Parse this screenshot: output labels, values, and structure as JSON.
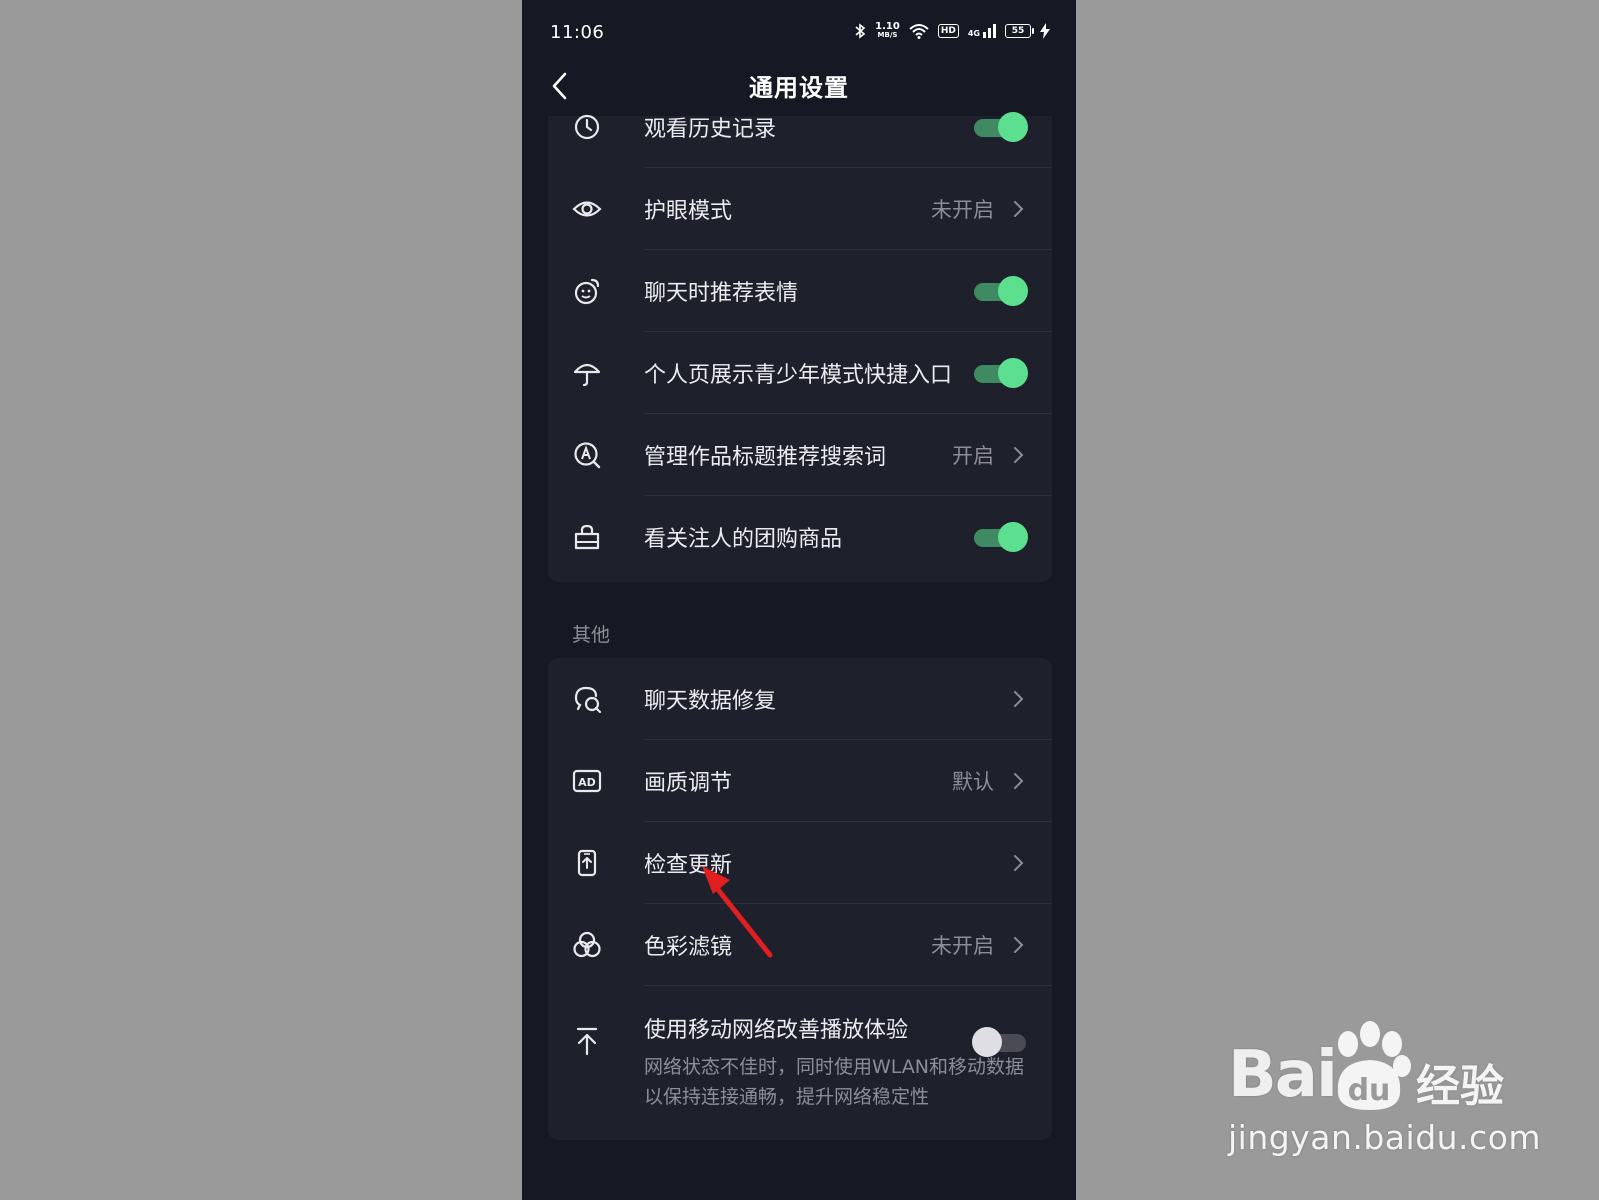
{
  "status_bar": {
    "time": "11:06",
    "net_speed": "1.10",
    "net_unit": "MB/S",
    "hd_badge": "HD",
    "signal_label": "4G",
    "battery": "55"
  },
  "navbar": {
    "title": "通用设置",
    "back_icon": "chevron-left-icon"
  },
  "group1": {
    "items": [
      {
        "label": "观看历史记录",
        "icon": "clock-icon",
        "control": "toggle",
        "on": true
      },
      {
        "label": "护眼模式",
        "icon": "eye-icon",
        "control": "link",
        "value": "未开启"
      },
      {
        "label": "聊天时推荐表情",
        "icon": "emoji-icon",
        "control": "toggle",
        "on": true
      },
      {
        "label": "个人页展示青少年模式快捷入口",
        "icon": "umbrella-icon",
        "control": "toggle",
        "on": true
      },
      {
        "label": "管理作品标题推荐搜索词",
        "icon": "search-a-icon",
        "control": "link",
        "value": "开启"
      },
      {
        "label": "看关注人的团购商品",
        "icon": "bag-icon",
        "control": "toggle",
        "on": true
      }
    ]
  },
  "section_other": {
    "header": "其他"
  },
  "group2": {
    "items": [
      {
        "label": "聊天数据修复",
        "icon": "chat-repair-icon",
        "control": "link",
        "value": ""
      },
      {
        "label": "画质调节",
        "icon": "ad-icon",
        "control": "link",
        "value": "默认"
      },
      {
        "label": "检查更新",
        "icon": "phone-update-icon",
        "control": "link",
        "value": ""
      },
      {
        "label": "色彩滤镜",
        "icon": "color-filter-icon",
        "control": "link",
        "value": "未开启"
      },
      {
        "label": "使用移动网络改善播放体验",
        "icon": "upload-icon",
        "control": "toggle",
        "on": false,
        "description_line1": "网络状态不佳时，同时使用WLAN和移动数据",
        "description_line2": "以保持连接通畅，提升网络稳定性"
      }
    ]
  },
  "annotation": {
    "icon": "red-arrow-icon"
  },
  "watermark": {
    "logo_text": "Bai",
    "logo_du": "du",
    "brand_text": "经验",
    "url": "jingyan.baidu.com"
  },
  "colors": {
    "background": "#161823",
    "card": "#1e202c",
    "accent_green": "#5ce08f",
    "arrow_red": "#e02020"
  }
}
